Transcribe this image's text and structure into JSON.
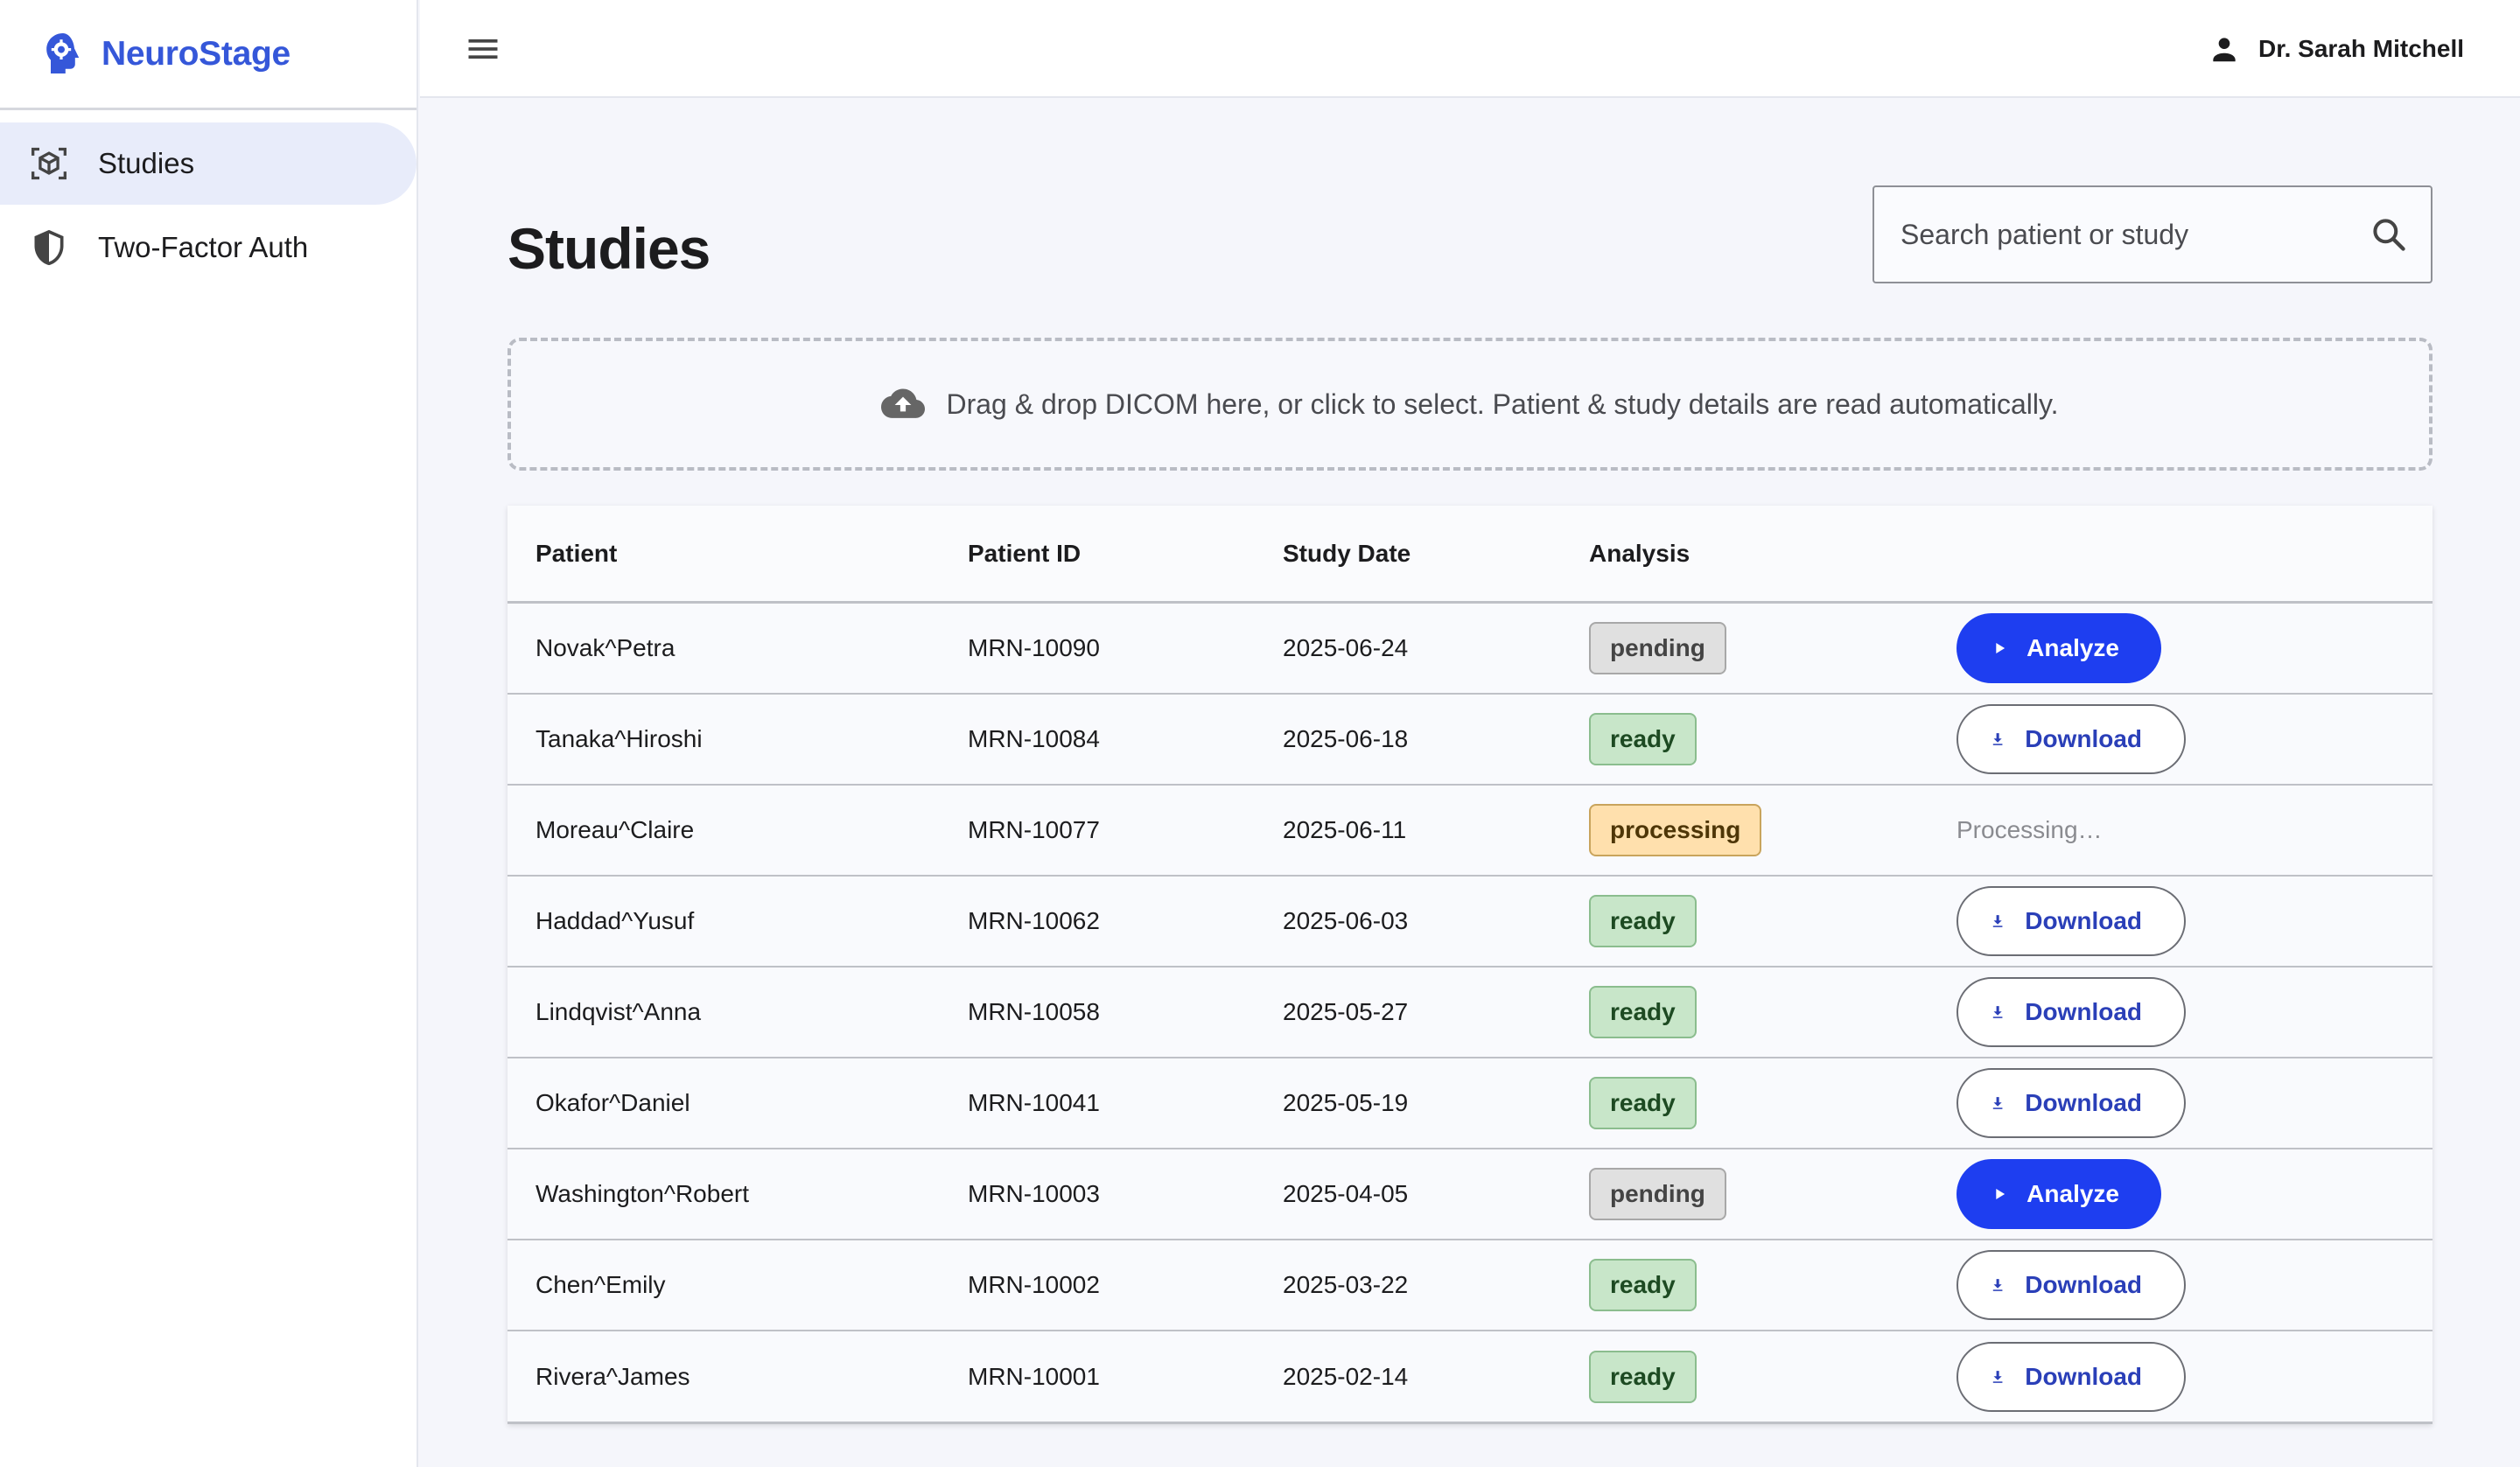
{
  "brand": {
    "name": "NeuroStage",
    "accent": "#3557d9",
    "icon": "brain-gear-icon"
  },
  "sidebar": {
    "items": [
      {
        "label": "Studies",
        "icon": "scan-cube-icon",
        "active": true
      },
      {
        "label": "Two-Factor Auth",
        "icon": "shield-icon",
        "active": false
      }
    ]
  },
  "header": {
    "menu_icon": "hamburger-menu-icon",
    "user_name": "Dr. Sarah Mitchell",
    "user_icon": "person-icon"
  },
  "main": {
    "title": "Studies",
    "search": {
      "placeholder": "Search patient or study",
      "value": ""
    },
    "dropzone": {
      "text": "Drag & drop DICOM here, or click to select. Patient & study details are read automatically.",
      "icon": "cloud-upload-icon"
    }
  },
  "table": {
    "headers": [
      "Patient",
      "Patient ID",
      "Study Date",
      "Analysis",
      ""
    ],
    "rows": [
      {
        "patient": "Novak^Petra",
        "patient_id": "MRN-10090",
        "study_date": "2025-06-24",
        "analysis": "pending",
        "action": "Analyze"
      },
      {
        "patient": "Tanaka^Hiroshi",
        "patient_id": "MRN-10084",
        "study_date": "2025-06-18",
        "analysis": "ready",
        "action": "Download"
      },
      {
        "patient": "Moreau^Claire",
        "patient_id": "MRN-10077",
        "study_date": "2025-06-11",
        "analysis": "processing",
        "action": "Processing…"
      },
      {
        "patient": "Haddad^Yusuf",
        "patient_id": "MRN-10062",
        "study_date": "2025-06-03",
        "analysis": "ready",
        "action": "Download"
      },
      {
        "patient": "Lindqvist^Anna",
        "patient_id": "MRN-10058",
        "study_date": "2025-05-27",
        "analysis": "ready",
        "action": "Download"
      },
      {
        "patient": "Okafor^Daniel",
        "patient_id": "MRN-10041",
        "study_date": "2025-05-19",
        "analysis": "ready",
        "action": "Download"
      },
      {
        "patient": "Washington^Robert",
        "patient_id": "MRN-10003",
        "study_date": "2025-04-05",
        "analysis": "pending",
        "action": "Analyze"
      },
      {
        "patient": "Chen^Emily",
        "patient_id": "MRN-10002",
        "study_date": "2025-03-22",
        "analysis": "ready",
        "action": "Download"
      },
      {
        "patient": "Rivera^James",
        "patient_id": "MRN-10001",
        "study_date": "2025-02-14",
        "analysis": "ready",
        "action": "Download"
      }
    ]
  },
  "colors": {
    "primary_button": "#1e3ef0",
    "pending_badge": "#e0e0e0",
    "ready_badge": "#c8e6c9",
    "processing_badge": "#ffe0ad"
  }
}
